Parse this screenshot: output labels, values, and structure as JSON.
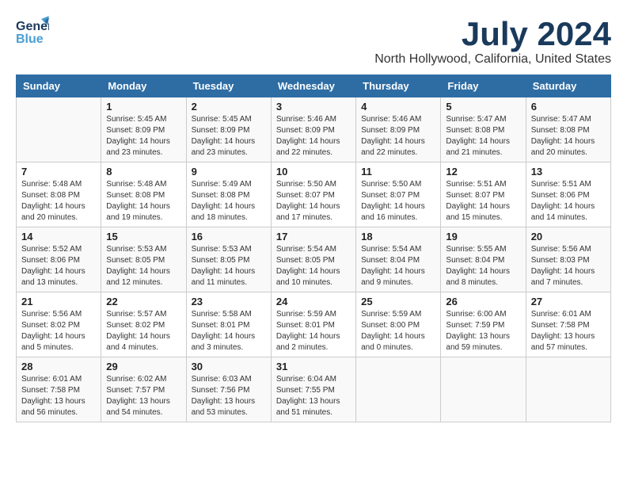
{
  "header": {
    "logo_general": "General",
    "logo_blue": "Blue",
    "month": "July 2024",
    "location": "North Hollywood, California, United States"
  },
  "weekdays": [
    "Sunday",
    "Monday",
    "Tuesday",
    "Wednesday",
    "Thursday",
    "Friday",
    "Saturday"
  ],
  "weeks": [
    [
      {
        "day": "",
        "sunrise": "",
        "sunset": "",
        "daylight": ""
      },
      {
        "day": "1",
        "sunrise": "Sunrise: 5:45 AM",
        "sunset": "Sunset: 8:09 PM",
        "daylight": "Daylight: 14 hours and 23 minutes."
      },
      {
        "day": "2",
        "sunrise": "Sunrise: 5:45 AM",
        "sunset": "Sunset: 8:09 PM",
        "daylight": "Daylight: 14 hours and 23 minutes."
      },
      {
        "day": "3",
        "sunrise": "Sunrise: 5:46 AM",
        "sunset": "Sunset: 8:09 PM",
        "daylight": "Daylight: 14 hours and 22 minutes."
      },
      {
        "day": "4",
        "sunrise": "Sunrise: 5:46 AM",
        "sunset": "Sunset: 8:09 PM",
        "daylight": "Daylight: 14 hours and 22 minutes."
      },
      {
        "day": "5",
        "sunrise": "Sunrise: 5:47 AM",
        "sunset": "Sunset: 8:08 PM",
        "daylight": "Daylight: 14 hours and 21 minutes."
      },
      {
        "day": "6",
        "sunrise": "Sunrise: 5:47 AM",
        "sunset": "Sunset: 8:08 PM",
        "daylight": "Daylight: 14 hours and 20 minutes."
      }
    ],
    [
      {
        "day": "7",
        "sunrise": "Sunrise: 5:48 AM",
        "sunset": "Sunset: 8:08 PM",
        "daylight": "Daylight: 14 hours and 20 minutes."
      },
      {
        "day": "8",
        "sunrise": "Sunrise: 5:48 AM",
        "sunset": "Sunset: 8:08 PM",
        "daylight": "Daylight: 14 hours and 19 minutes."
      },
      {
        "day": "9",
        "sunrise": "Sunrise: 5:49 AM",
        "sunset": "Sunset: 8:08 PM",
        "daylight": "Daylight: 14 hours and 18 minutes."
      },
      {
        "day": "10",
        "sunrise": "Sunrise: 5:50 AM",
        "sunset": "Sunset: 8:07 PM",
        "daylight": "Daylight: 14 hours and 17 minutes."
      },
      {
        "day": "11",
        "sunrise": "Sunrise: 5:50 AM",
        "sunset": "Sunset: 8:07 PM",
        "daylight": "Daylight: 14 hours and 16 minutes."
      },
      {
        "day": "12",
        "sunrise": "Sunrise: 5:51 AM",
        "sunset": "Sunset: 8:07 PM",
        "daylight": "Daylight: 14 hours and 15 minutes."
      },
      {
        "day": "13",
        "sunrise": "Sunrise: 5:51 AM",
        "sunset": "Sunset: 8:06 PM",
        "daylight": "Daylight: 14 hours and 14 minutes."
      }
    ],
    [
      {
        "day": "14",
        "sunrise": "Sunrise: 5:52 AM",
        "sunset": "Sunset: 8:06 PM",
        "daylight": "Daylight: 14 hours and 13 minutes."
      },
      {
        "day": "15",
        "sunrise": "Sunrise: 5:53 AM",
        "sunset": "Sunset: 8:05 PM",
        "daylight": "Daylight: 14 hours and 12 minutes."
      },
      {
        "day": "16",
        "sunrise": "Sunrise: 5:53 AM",
        "sunset": "Sunset: 8:05 PM",
        "daylight": "Daylight: 14 hours and 11 minutes."
      },
      {
        "day": "17",
        "sunrise": "Sunrise: 5:54 AM",
        "sunset": "Sunset: 8:05 PM",
        "daylight": "Daylight: 14 hours and 10 minutes."
      },
      {
        "day": "18",
        "sunrise": "Sunrise: 5:54 AM",
        "sunset": "Sunset: 8:04 PM",
        "daylight": "Daylight: 14 hours and 9 minutes."
      },
      {
        "day": "19",
        "sunrise": "Sunrise: 5:55 AM",
        "sunset": "Sunset: 8:04 PM",
        "daylight": "Daylight: 14 hours and 8 minutes."
      },
      {
        "day": "20",
        "sunrise": "Sunrise: 5:56 AM",
        "sunset": "Sunset: 8:03 PM",
        "daylight": "Daylight: 14 hours and 7 minutes."
      }
    ],
    [
      {
        "day": "21",
        "sunrise": "Sunrise: 5:56 AM",
        "sunset": "Sunset: 8:02 PM",
        "daylight": "Daylight: 14 hours and 5 minutes."
      },
      {
        "day": "22",
        "sunrise": "Sunrise: 5:57 AM",
        "sunset": "Sunset: 8:02 PM",
        "daylight": "Daylight: 14 hours and 4 minutes."
      },
      {
        "day": "23",
        "sunrise": "Sunrise: 5:58 AM",
        "sunset": "Sunset: 8:01 PM",
        "daylight": "Daylight: 14 hours and 3 minutes."
      },
      {
        "day": "24",
        "sunrise": "Sunrise: 5:59 AM",
        "sunset": "Sunset: 8:01 PM",
        "daylight": "Daylight: 14 hours and 2 minutes."
      },
      {
        "day": "25",
        "sunrise": "Sunrise: 5:59 AM",
        "sunset": "Sunset: 8:00 PM",
        "daylight": "Daylight: 14 hours and 0 minutes."
      },
      {
        "day": "26",
        "sunrise": "Sunrise: 6:00 AM",
        "sunset": "Sunset: 7:59 PM",
        "daylight": "Daylight: 13 hours and 59 minutes."
      },
      {
        "day": "27",
        "sunrise": "Sunrise: 6:01 AM",
        "sunset": "Sunset: 7:58 PM",
        "daylight": "Daylight: 13 hours and 57 minutes."
      }
    ],
    [
      {
        "day": "28",
        "sunrise": "Sunrise: 6:01 AM",
        "sunset": "Sunset: 7:58 PM",
        "daylight": "Daylight: 13 hours and 56 minutes."
      },
      {
        "day": "29",
        "sunrise": "Sunrise: 6:02 AM",
        "sunset": "Sunset: 7:57 PM",
        "daylight": "Daylight: 13 hours and 54 minutes."
      },
      {
        "day": "30",
        "sunrise": "Sunrise: 6:03 AM",
        "sunset": "Sunset: 7:56 PM",
        "daylight": "Daylight: 13 hours and 53 minutes."
      },
      {
        "day": "31",
        "sunrise": "Sunrise: 6:04 AM",
        "sunset": "Sunset: 7:55 PM",
        "daylight": "Daylight: 13 hours and 51 minutes."
      },
      {
        "day": "",
        "sunrise": "",
        "sunset": "",
        "daylight": ""
      },
      {
        "day": "",
        "sunrise": "",
        "sunset": "",
        "daylight": ""
      },
      {
        "day": "",
        "sunrise": "",
        "sunset": "",
        "daylight": ""
      }
    ]
  ]
}
